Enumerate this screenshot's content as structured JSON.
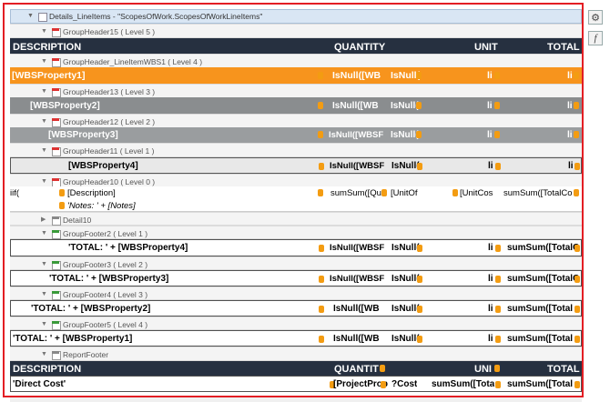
{
  "details_title": "Details_LineItems - \"ScopesOfWork.ScopesOfWorkLineItems\"",
  "headers": {
    "gh15": "GroupHeader15 ( Level 5 )",
    "gh_wbs1": "GroupHeader_LineItemWBS1 ( Level 4 )",
    "gh13": "GroupHeader13 ( Level 3 )",
    "gh12": "GroupHeader12 ( Level 2 )",
    "gh11": "GroupHeader11 ( Level 1 )",
    "gh10": "GroupHeader10 ( Level 0 )",
    "detail10": "Detail10",
    "gf2": "GroupFooter2 ( Level 1 )",
    "gf3": "GroupFooter3 ( Level 2 )",
    "gf4": "GroupFooter4 ( Level 3 )",
    "gf5": "GroupFooter5 ( Level 4 )",
    "report_footer": "ReportFooter"
  },
  "columns": {
    "description": "DESCRIPTION",
    "quantity": "QUANTITY",
    "unit": "UNIT",
    "total": "TOTAL"
  },
  "footer_columns": {
    "description": "DESCRIPTION",
    "quantity": "QUANTIT",
    "unit": "UNI",
    "total": "TOTAL"
  },
  "rows": {
    "wbs1": {
      "desc": "[WBSProperty1]",
      "q": "IsNull([WB",
      "u1": "IsNull(",
      "u2": "li",
      "t": "li"
    },
    "wbs2": {
      "desc": "[WBSProperty2]",
      "q": "IsNull([WB",
      "u1": "IsNull(",
      "u2": "li",
      "t": "li"
    },
    "wbs3": {
      "desc": "[WBSProperty3]",
      "q": "IsNull([WBSF",
      "u1": "IsNull(",
      "u2": "li",
      "t": "li"
    },
    "wbs4": {
      "desc": "[WBSProperty4]",
      "q": "IsNull([WBSF",
      "u1": "IsNull(",
      "u2": "li",
      "t": "li"
    },
    "detail": {
      "iif": "iif(",
      "desc": "[Description]",
      "notes": "'Notes: ' + [Notes]",
      "q": "sumSum([Qu",
      "u1": "[UnitOf",
      "u2": "[UnitCos",
      "t": "sumSum([TotalCo"
    },
    "gf2": {
      "desc": "'TOTAL: ' + [WBSProperty4]",
      "q": "IsNull([WBSF",
      "u1": "IsNull(",
      "u2": "li",
      "t": "sumSum([TotalC"
    },
    "gf3": {
      "desc": "'TOTAL: ' + [WBSProperty3]",
      "q": "IsNull([WBSF",
      "u1": "IsNull(",
      "u2": "li",
      "t": "sumSum([TotalC"
    },
    "gf4": {
      "desc": "'TOTAL: ' + [WBSProperty2]",
      "q": "IsNull([WB",
      "u1": "IsNull(",
      "u2": "li",
      "t": "sumSum([Total"
    },
    "gf5": {
      "desc": "'TOTAL: ' + [WBSProperty1]",
      "q": "IsNull([WB",
      "u1": "IsNull(",
      "u2": "li",
      "t": "sumSum([Total"
    },
    "direct": {
      "desc": "'Direct Cost'",
      "q": "[ProjectProp",
      "u1": "?Cost",
      "u2": "sumSum([Tota",
      "t": "sumSum([Total"
    }
  },
  "icons": {
    "gear": "⚙",
    "function": "f"
  },
  "colors": {
    "dark": "#263040",
    "orange": "#f7941d",
    "grey": "#8a8d8f",
    "frame": "#e31e24"
  }
}
